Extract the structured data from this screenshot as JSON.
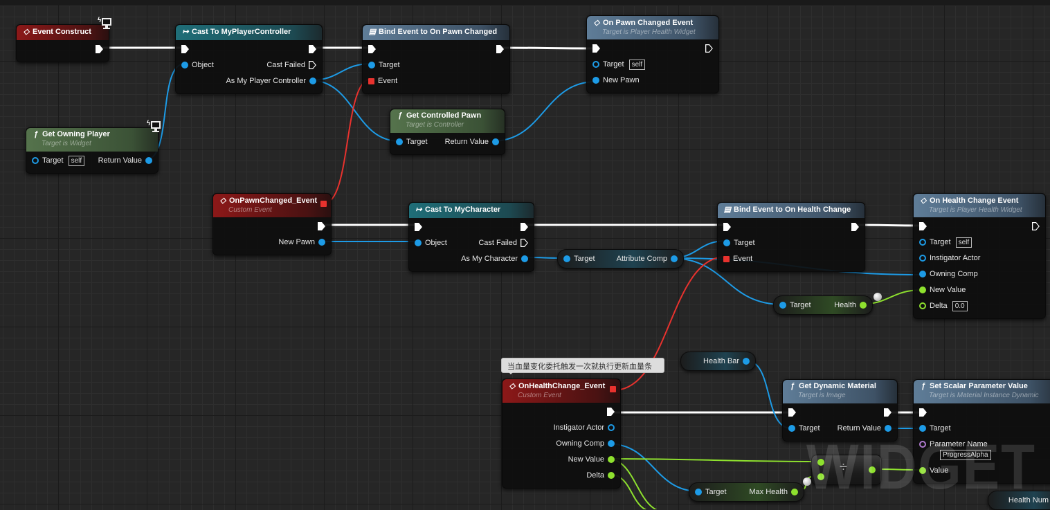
{
  "editor": {
    "watermark": "WIDGET BL"
  },
  "comment": "当血量变化委托触发一次就执行更新血量条",
  "colors": {
    "exec": "#ffffff",
    "object": "#1d9be6",
    "float": "#8ee12e",
    "delegate": "#e8322e",
    "name": "#b07ad0"
  },
  "nodes": [
    {
      "id": "event-construct",
      "kind": "event",
      "icon": "event-diamond-icon",
      "title": "Event Construct",
      "client_only": true,
      "rows": [
        [
          null,
          {
            "type": "exec"
          }
        ]
      ]
    },
    {
      "id": "cast-to-myplayercontroller",
      "kind": "cast",
      "icon": "cast-arrow-icon",
      "title": "Cast To MyPlayerController",
      "rows": [
        [
          {
            "type": "exec"
          },
          {
            "type": "exec"
          }
        ],
        [
          {
            "type": "object",
            "label": "Object"
          },
          {
            "type": "exec",
            "label": "Cast Failed",
            "hollow": true
          }
        ],
        [
          null,
          {
            "type": "object",
            "label": "As My Player Controller"
          }
        ]
      ]
    },
    {
      "id": "bind-on-pawn-changed",
      "kind": "bind",
      "icon": "bind-event-icon",
      "title": "Bind Event to On Pawn Changed",
      "rows": [
        [
          {
            "type": "exec"
          },
          {
            "type": "exec"
          }
        ],
        [
          {
            "type": "object",
            "label": "Target"
          },
          null
        ],
        [
          {
            "type": "delegate",
            "label": "Event"
          },
          null
        ]
      ]
    },
    {
      "id": "on-pawn-changed-event",
      "kind": "blue",
      "icon": "event-diamond-icon",
      "title": "On Pawn Changed Event",
      "subtitle": "Target is Player Health Widget",
      "rows": [
        [
          {
            "type": "exec"
          },
          {
            "type": "exec",
            "hollow": true
          }
        ],
        [
          {
            "type": "object",
            "label": "Target",
            "hollow": true,
            "default": "self"
          },
          null
        ],
        [
          {
            "type": "object",
            "label": "New Pawn"
          },
          null
        ]
      ]
    },
    {
      "id": "get-controlled-pawn",
      "kind": "func",
      "icon": "function-icon",
      "title": "Get Controlled Pawn",
      "subtitle": "Target is Controller",
      "rows": [
        [
          {
            "type": "object",
            "label": "Target"
          },
          {
            "type": "object",
            "label": "Return Value"
          }
        ]
      ]
    },
    {
      "id": "get-owning-player",
      "kind": "func",
      "icon": "function-icon",
      "title": "Get Owning Player",
      "subtitle": "Target is Widget",
      "client_only": true,
      "rows": [
        [
          {
            "type": "object",
            "label": "Target",
            "hollow": true,
            "default": "self"
          },
          {
            "type": "object",
            "label": "Return Value"
          }
        ]
      ]
    },
    {
      "id": "onpawnchanged-custom-event",
      "kind": "event",
      "icon": "event-diamond-icon",
      "title": "OnPawnChanged_Event",
      "subtitle": "Custom Event",
      "delegate_out": true,
      "rows": [
        [
          null,
          {
            "type": "exec"
          }
        ],
        [
          null,
          {
            "type": "object",
            "label": "New Pawn"
          }
        ]
      ]
    },
    {
      "id": "cast-to-mycharacter",
      "kind": "cast",
      "icon": "cast-arrow-icon",
      "title": "Cast To MyCharacter",
      "rows": [
        [
          {
            "type": "exec"
          },
          {
            "type": "exec"
          }
        ],
        [
          {
            "type": "object",
            "label": "Object"
          },
          {
            "type": "exec",
            "label": "Cast Failed",
            "hollow": true
          }
        ],
        [
          null,
          {
            "type": "object",
            "label": "As My Character"
          }
        ]
      ]
    },
    {
      "id": "bind-on-health-change",
      "kind": "bind",
      "icon": "bind-event-icon",
      "title": "Bind Event to On Health Change",
      "rows": [
        [
          {
            "type": "exec"
          },
          {
            "type": "exec"
          }
        ],
        [
          {
            "type": "object",
            "label": "Target"
          },
          null
        ],
        [
          {
            "type": "delegate",
            "label": "Event"
          },
          null
        ]
      ]
    },
    {
      "id": "on-health-change-event",
      "kind": "blue",
      "icon": "event-diamond-icon",
      "title": "On Health Change Event",
      "subtitle": "Target is Player Health Widget",
      "rows": [
        [
          {
            "type": "exec"
          },
          {
            "type": "exec",
            "hollow": true
          }
        ],
        [
          {
            "type": "object",
            "label": "Target",
            "hollow": true,
            "default": "self"
          },
          null
        ],
        [
          {
            "type": "object",
            "label": "Instigator Actor",
            "hollow": true
          },
          null
        ],
        [
          {
            "type": "object",
            "label": "Owning Comp"
          },
          null
        ],
        [
          {
            "type": "float",
            "label": "New Value"
          },
          null
        ],
        [
          {
            "type": "float",
            "label": "Delta",
            "hollow": true,
            "default": "0.0"
          },
          null
        ]
      ]
    },
    {
      "id": "onhealthchange-custom-event",
      "kind": "event",
      "icon": "event-diamond-icon",
      "title": "OnHealthChange_Event",
      "subtitle": "Custom Event",
      "delegate_out": true,
      "rows": [
        [
          null,
          {
            "type": "exec"
          }
        ],
        [
          null,
          {
            "type": "object",
            "label": "Instigator Actor",
            "hollow": true
          }
        ],
        [
          null,
          {
            "type": "object",
            "label": "Owning Comp"
          }
        ],
        [
          null,
          {
            "type": "float",
            "label": "New Value"
          }
        ],
        [
          null,
          {
            "type": "float",
            "label": "Delta"
          }
        ]
      ]
    },
    {
      "id": "get-dynamic-material",
      "kind": "blue",
      "icon": "function-icon",
      "title": "Get Dynamic Material",
      "subtitle": "Target is Image",
      "rows": [
        [
          {
            "type": "exec"
          },
          {
            "type": "exec"
          }
        ],
        [
          {
            "type": "object",
            "label": "Target"
          },
          {
            "type": "object",
            "label": "Return Value"
          }
        ]
      ]
    },
    {
      "id": "set-scalar-parameter-value",
      "kind": "blue",
      "icon": "function-icon",
      "title": "Set Scalar Parameter Value",
      "subtitle": "Target is Material Instance Dynamic",
      "rows": [
        [
          {
            "type": "exec"
          },
          null
        ],
        [
          {
            "type": "object",
            "label": "Target"
          },
          null
        ],
        [
          {
            "type": "name",
            "label": "Parameter Name",
            "default": "ProgressAlpha",
            "default_below": true
          },
          null
        ],
        [
          {
            "type": "float",
            "label": "Value"
          },
          null
        ]
      ]
    }
  ],
  "pills": [
    {
      "id": "get-attribute-comp",
      "tint": "blue",
      "left": {
        "type": "object",
        "label": "Target"
      },
      "right": {
        "type": "object",
        "label": "Attribute Comp"
      }
    },
    {
      "id": "get-health",
      "tint": "green",
      "left": {
        "type": "object",
        "label": "Target"
      },
      "right": {
        "type": "float",
        "label": "Health"
      }
    },
    {
      "id": "get-health-bar",
      "tint": "blue",
      "left": null,
      "right": {
        "type": "object",
        "label": "Health Bar"
      }
    },
    {
      "id": "get-max-health",
      "tint": "green",
      "left": {
        "type": "object",
        "label": "Target"
      },
      "right": {
        "type": "float",
        "label": "Max Health"
      }
    },
    {
      "id": "divide-float",
      "tint": "gray",
      "operator": "÷",
      "left": {
        "type": "float"
      },
      "left2": {
        "type": "float"
      },
      "right": {
        "type": "float"
      }
    },
    {
      "id": "get-health-num",
      "tint": "blue",
      "left": null,
      "right": {
        "type": "object",
        "label": "Health Num"
      }
    }
  ]
}
